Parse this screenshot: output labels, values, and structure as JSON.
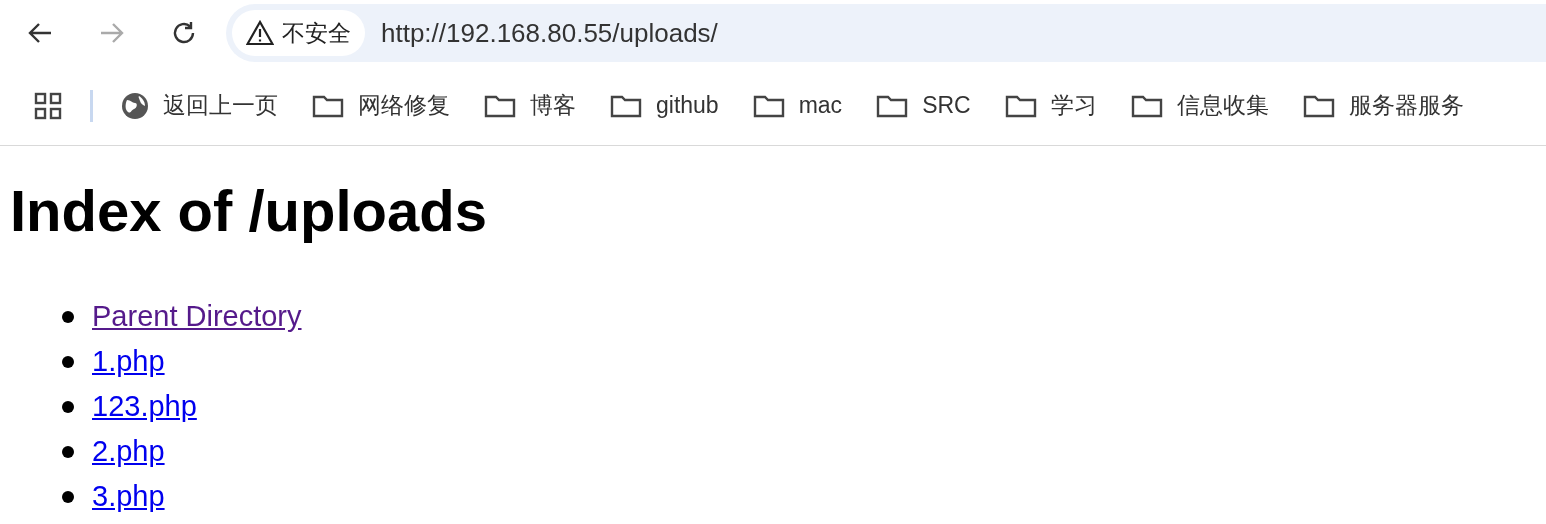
{
  "toolbar": {
    "security_label": "不安全",
    "url": "http://192.168.80.55/uploads/"
  },
  "bookmarks": [
    {
      "kind": "globe",
      "label": "返回上一页"
    },
    {
      "kind": "folder",
      "label": "网络修复"
    },
    {
      "kind": "folder",
      "label": "博客"
    },
    {
      "kind": "folder",
      "label": "github"
    },
    {
      "kind": "folder",
      "label": "mac"
    },
    {
      "kind": "folder",
      "label": "SRC"
    },
    {
      "kind": "folder",
      "label": "学习"
    },
    {
      "kind": "folder",
      "label": "信息收集"
    },
    {
      "kind": "folder",
      "label": "服务器服务"
    }
  ],
  "page": {
    "heading": "Index of /uploads",
    "links": [
      {
        "label": "Parent Directory",
        "visited": true
      },
      {
        "label": "1.php",
        "visited": false
      },
      {
        "label": "123.php",
        "visited": false
      },
      {
        "label": "2.php",
        "visited": false
      },
      {
        "label": "3.php",
        "visited": false
      }
    ]
  }
}
